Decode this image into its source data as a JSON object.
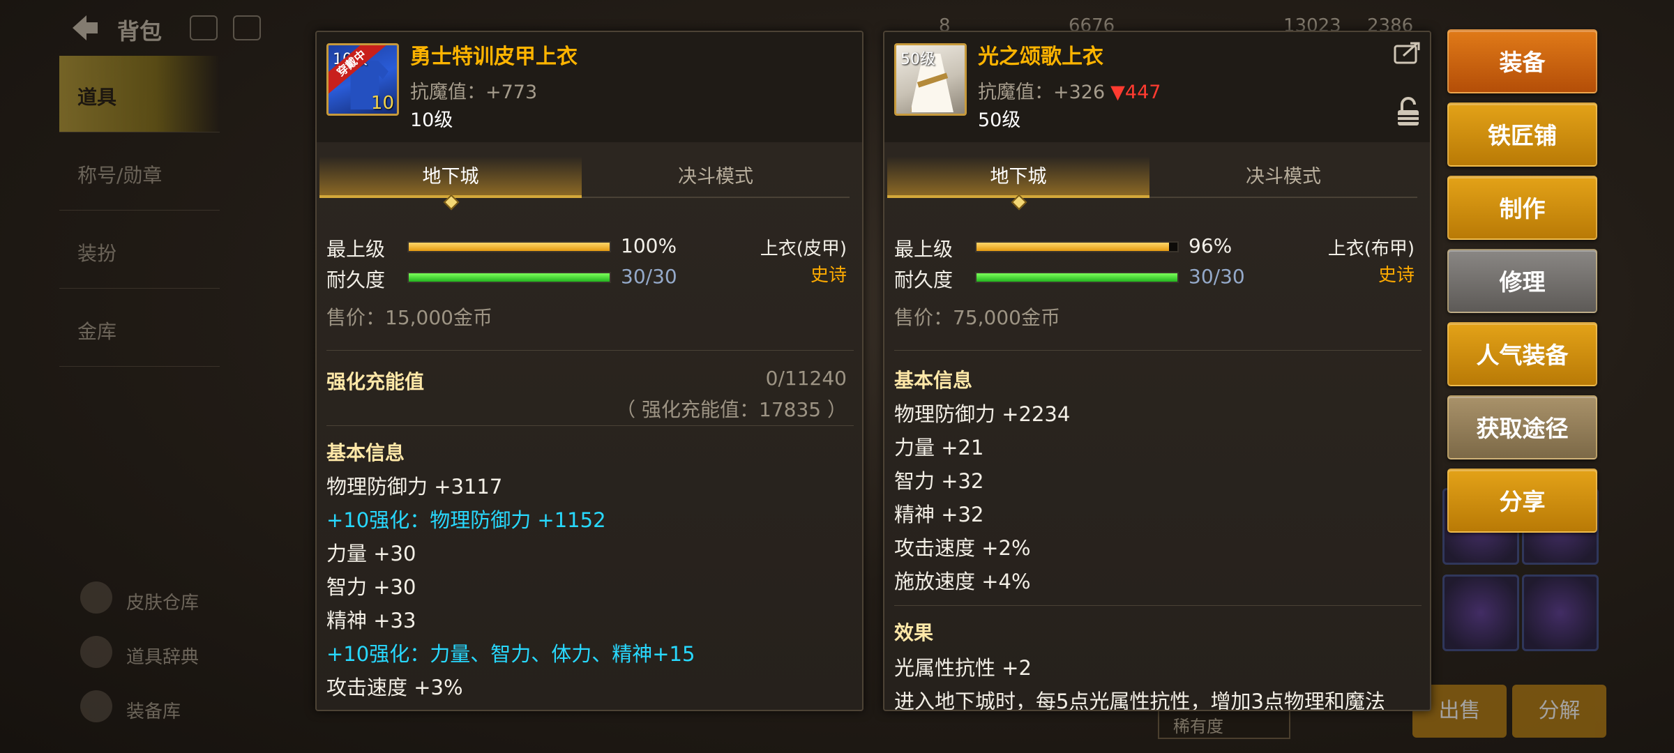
{
  "background": {
    "title": "背包",
    "top_values": [
      "8",
      "6676",
      "13023",
      "2386"
    ],
    "sidebar": [
      "道具",
      "称号/勋章",
      "装扮",
      "金库"
    ],
    "bottom_items": [
      "皮肤仓库",
      "道具辞典",
      "装备库"
    ],
    "bottom_buttons": [
      "出售",
      "分解"
    ],
    "sort_label": "稀有度"
  },
  "left_item": {
    "name": "勇士特训皮甲上衣",
    "corner_level": "10级",
    "equipped_badge": "穿戴中",
    "plus": "10",
    "antimagic": "抗魔值：+773",
    "level": "10级",
    "tabs": {
      "active": "地下城",
      "inactive": "决斗模式"
    },
    "grade_label": "最上级",
    "grade_value": "100%",
    "grade_fraction": 1.0,
    "durability_label": "耐久度",
    "durability_value": "30/30",
    "durability_fraction": 1.0,
    "slot": "上衣(皮甲)",
    "rarity": "史诗",
    "price": "售价：15,000金币",
    "charge_title": "强化充能值",
    "charge_value": "0/11240",
    "charge_note": "（ 强化充能值：17835 ）",
    "basic_title": "基本信息",
    "stats": [
      {
        "text": "物理防御力 +3117",
        "style": "normal"
      },
      {
        "text": "+10强化：物理防御力 +1152",
        "style": "cyan"
      },
      {
        "text": "力量 +30",
        "style": "normal"
      },
      {
        "text": "智力 +30",
        "style": "normal"
      },
      {
        "text": "精神 +33",
        "style": "normal"
      },
      {
        "text": "+10强化：力量、智力、体力、精神+15",
        "style": "cyan"
      },
      {
        "text": "攻击速度 +3%",
        "style": "normal"
      }
    ]
  },
  "right_item": {
    "name": "光之颂歌上衣",
    "corner_level": "50级",
    "antimagic_base": "抗魔值：+326",
    "antimagic_diff": "▼447",
    "level": "50级",
    "tabs": {
      "active": "地下城",
      "inactive": "决斗模式"
    },
    "grade_label": "最上级",
    "grade_value": "96%",
    "grade_fraction": 0.96,
    "durability_label": "耐久度",
    "durability_value": "30/30",
    "durability_fraction": 1.0,
    "slot": "上衣(布甲)",
    "rarity": "史诗",
    "price": "售价：75,000金币",
    "basic_title": "基本信息",
    "stats": [
      "物理防御力 +2234",
      "力量 +21",
      "智力 +32",
      "精神 +32",
      "攻击速度 +2%",
      "施放速度 +4%"
    ],
    "effect_title": "效果",
    "effects": [
      "光属性抗性 +2",
      "进入地下城时，每5点光属性抗性，增加3点物理和魔法"
    ]
  },
  "actions": [
    "装备",
    "铁匠铺",
    "制作",
    "修理",
    "人气装备",
    "获取途径",
    "分享"
  ],
  "colors": {
    "item_name": "#ffb400",
    "rarity_epic": "#ffab00",
    "enhance_cyan": "#28d9ff",
    "down_red": "#ff3b30",
    "durability_blue": "#94a9c9"
  }
}
